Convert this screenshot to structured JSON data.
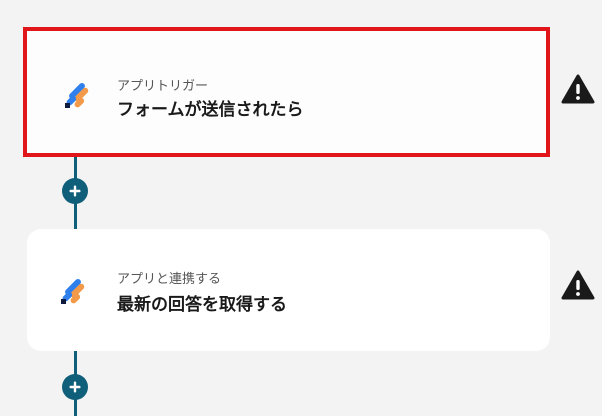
{
  "flow": {
    "steps": [
      {
        "kind_label": "アプリトリガー",
        "title": "フォームが送信されたら",
        "app_icon": "form-app-icon",
        "status_icon": "warning-icon",
        "selected": true
      },
      {
        "kind_label": "アプリと連携する",
        "title": "最新の回答を取得する",
        "app_icon": "form-app-icon",
        "status_icon": "warning-icon",
        "selected": false
      }
    ],
    "add_button_icon": "plus-icon"
  },
  "colors": {
    "background": "#f3f3f4",
    "connector": "#0f5f7a",
    "selected_border": "#e0161b",
    "warning": "#1a1a1a",
    "icon_blue": "#2f80ed",
    "icon_orange": "#f2994a",
    "icon_navy": "#0e1b3d"
  }
}
